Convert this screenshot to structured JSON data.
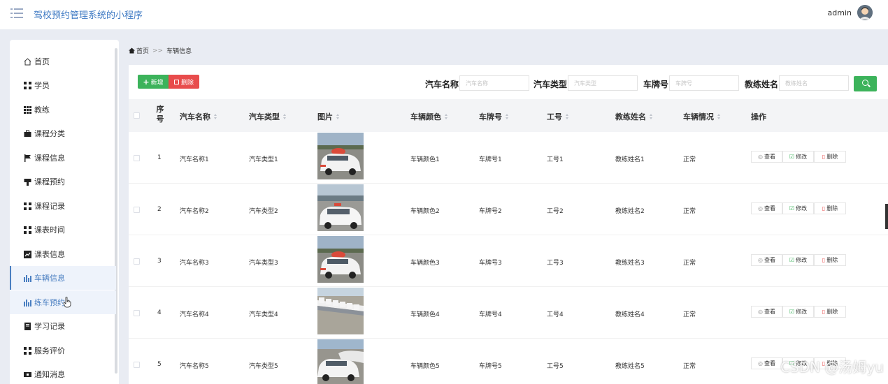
{
  "header": {
    "title": "驾校预约管理系统的小程序",
    "user": "admin"
  },
  "sidebar": {
    "items": [
      {
        "label": "首页",
        "icon": "home-icon"
      },
      {
        "label": "学员",
        "icon": "grid-icon"
      },
      {
        "label": "教练",
        "icon": "grid9-icon"
      },
      {
        "label": "课程分类",
        "icon": "briefcase-icon"
      },
      {
        "label": "课程信息",
        "icon": "flag-icon"
      },
      {
        "label": "课程预约",
        "icon": "bookmark-icon"
      },
      {
        "label": "课程记录",
        "icon": "grid-icon"
      },
      {
        "label": "课表时间",
        "icon": "grid-icon"
      },
      {
        "label": "课表信息",
        "icon": "chart-icon"
      },
      {
        "label": "车辆信息",
        "icon": "bar-chart-icon"
      },
      {
        "label": "练车预约",
        "icon": "bar-chart-icon"
      },
      {
        "label": "学习记录",
        "icon": "book-icon"
      },
      {
        "label": "服务评价",
        "icon": "grid-icon"
      },
      {
        "label": "通知消息",
        "icon": "tag-icon"
      }
    ]
  },
  "breadcrumb": {
    "home": "首页",
    "sep": ">>",
    "current": "车辆信息"
  },
  "toolbar": {
    "add_label": "新增",
    "delete_label": "删除",
    "filters": [
      {
        "label": "汽车名称",
        "placeholder": "汽车名称"
      },
      {
        "label": "汽车类型",
        "placeholder": "汽车类型"
      },
      {
        "label": "车牌号",
        "placeholder": "车牌号"
      },
      {
        "label": "教练姓名",
        "placeholder": "教练姓名"
      }
    ]
  },
  "table": {
    "columns": {
      "index": "序号",
      "car_name": "汽车名称",
      "car_type": "汽车类型",
      "image": "图片",
      "color": "车辆颜色",
      "plate": "车牌号",
      "job_no": "工号",
      "coach": "教练姓名",
      "status": "车辆情况",
      "actions": "操作"
    },
    "rows": [
      {
        "index": "1",
        "car_name": "汽车名称1",
        "car_type": "汽车类型1",
        "color": "车辆颜色1",
        "plate": "车牌号1",
        "job_no": "工号1",
        "coach": "教练姓名1",
        "status": "正常"
      },
      {
        "index": "2",
        "car_name": "汽车名称2",
        "car_type": "汽车类型2",
        "color": "车辆颜色2",
        "plate": "车牌号2",
        "job_no": "工号2",
        "coach": "教练姓名2",
        "status": "正常"
      },
      {
        "index": "3",
        "car_name": "汽车名称3",
        "car_type": "汽车类型3",
        "color": "车辆颜色3",
        "plate": "车牌号3",
        "job_no": "工号3",
        "coach": "教练姓名3",
        "status": "正常"
      },
      {
        "index": "4",
        "car_name": "汽车名称4",
        "car_type": "汽车类型4",
        "color": "车辆颜色4",
        "plate": "车牌号4",
        "job_no": "工号4",
        "coach": "教练姓名4",
        "status": "正常"
      },
      {
        "index": "5",
        "car_name": "汽车名称5",
        "car_type": "汽车类型5",
        "color": "车辆颜色5",
        "plate": "车牌号5",
        "job_no": "工号5",
        "coach": "教练姓名5",
        "status": "正常"
      }
    ],
    "actions": {
      "view": "查看",
      "edit": "修改",
      "delete": "删除"
    }
  },
  "watermark": "CSDN @汤姆yu",
  "colors": {
    "accent": "#4a7fc1",
    "success": "#3cb35b",
    "danger": "#e84c4c"
  }
}
